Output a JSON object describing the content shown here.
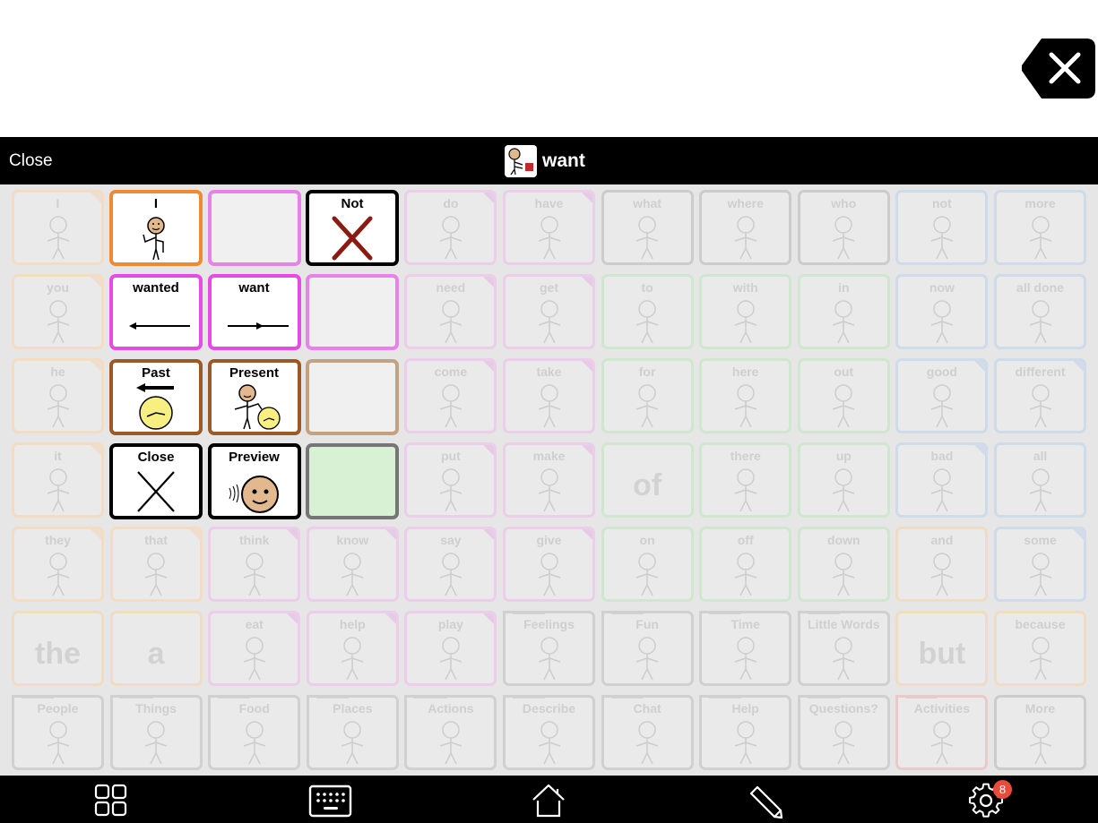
{
  "window": {
    "close_label": "Close",
    "title": "want",
    "title_icon": "want-symbol-icon"
  },
  "backspace": {
    "icon": "backspace-clear-icon"
  },
  "colors": {
    "pronoun": "#f0a04b",
    "verb": "#e987ea",
    "preposition": "#9ed89e",
    "adjective": "#9dc1e8",
    "question": "#9a9a9a",
    "folder": "#9a9a9a",
    "article": "#f0c080",
    "badge": "#e74c3c"
  },
  "board": {
    "cells": [
      {
        "label": "I",
        "type": "pronoun",
        "fold": true
      },
      {
        "label": "",
        "type": "hidden"
      },
      {
        "label": "",
        "type": "hidden"
      },
      {
        "label": "",
        "type": "hidden"
      },
      {
        "label": "do",
        "type": "verb",
        "fold": true
      },
      {
        "label": "have",
        "type": "verb",
        "fold": true
      },
      {
        "label": "what",
        "type": "question"
      },
      {
        "label": "where",
        "type": "question"
      },
      {
        "label": "who",
        "type": "question"
      },
      {
        "label": "not",
        "type": "adjective"
      },
      {
        "label": "more",
        "type": "adjective"
      },
      {
        "label": "you",
        "type": "pronoun",
        "fold": true
      },
      {
        "label": "",
        "type": "hidden"
      },
      {
        "label": "",
        "type": "hidden"
      },
      {
        "label": "",
        "type": "hidden"
      },
      {
        "label": "need",
        "type": "verb",
        "fold": true
      },
      {
        "label": "get",
        "type": "verb",
        "fold": true
      },
      {
        "label": "to",
        "type": "preposition"
      },
      {
        "label": "with",
        "type": "preposition"
      },
      {
        "label": "in",
        "type": "preposition"
      },
      {
        "label": "now",
        "type": "adjective"
      },
      {
        "label": "all done",
        "type": "adjective"
      },
      {
        "label": "he",
        "type": "pronoun",
        "fold": true
      },
      {
        "label": "",
        "type": "hidden"
      },
      {
        "label": "",
        "type": "hidden"
      },
      {
        "label": "",
        "type": "hidden"
      },
      {
        "label": "come",
        "type": "verb",
        "fold": true
      },
      {
        "label": "take",
        "type": "verb",
        "fold": true
      },
      {
        "label": "for",
        "type": "preposition"
      },
      {
        "label": "here",
        "type": "preposition"
      },
      {
        "label": "out",
        "type": "preposition"
      },
      {
        "label": "good",
        "type": "adjective",
        "fold": true
      },
      {
        "label": "different",
        "type": "adjective",
        "fold": true
      },
      {
        "label": "it",
        "type": "pronoun",
        "fold": true
      },
      {
        "label": "",
        "type": "hidden"
      },
      {
        "label": "",
        "type": "hidden"
      },
      {
        "label": "",
        "type": "hidden"
      },
      {
        "label": "put",
        "type": "verb",
        "fold": true
      },
      {
        "label": "make",
        "type": "verb",
        "fold": true
      },
      {
        "label": "",
        "big": "of",
        "type": "preposition"
      },
      {
        "label": "there",
        "type": "preposition"
      },
      {
        "label": "up",
        "type": "preposition"
      },
      {
        "label": "bad",
        "type": "adjective",
        "fold": true
      },
      {
        "label": "all",
        "type": "adjective"
      },
      {
        "label": "they",
        "type": "pronoun",
        "fold": true
      },
      {
        "label": "that",
        "type": "pronoun",
        "fold": true
      },
      {
        "label": "think",
        "type": "verb",
        "fold": true
      },
      {
        "label": "know",
        "type": "verb",
        "fold": true
      },
      {
        "label": "say",
        "type": "verb",
        "fold": true
      },
      {
        "label": "give",
        "type": "verb",
        "fold": true
      },
      {
        "label": "on",
        "type": "preposition"
      },
      {
        "label": "off",
        "type": "preposition"
      },
      {
        "label": "down",
        "type": "preposition"
      },
      {
        "label": "and",
        "type": "article"
      },
      {
        "label": "some",
        "type": "adjective",
        "fold": true
      },
      {
        "label": "",
        "big": "the",
        "type": "article"
      },
      {
        "label": "",
        "big": "a",
        "type": "article"
      },
      {
        "label": "eat",
        "type": "verb",
        "fold": true
      },
      {
        "label": "help",
        "type": "verb",
        "fold": true
      },
      {
        "label": "play",
        "type": "verb",
        "fold": true
      },
      {
        "label": "Feelings",
        "type": "folder"
      },
      {
        "label": "Fun",
        "type": "folder"
      },
      {
        "label": "Time",
        "type": "folder"
      },
      {
        "label": "Little Words",
        "type": "folder"
      },
      {
        "label": "",
        "big": "but",
        "type": "article"
      },
      {
        "label": "because",
        "type": "article"
      },
      {
        "label": "People",
        "type": "folder"
      },
      {
        "label": "Things",
        "type": "folder"
      },
      {
        "label": "Food",
        "type": "folder"
      },
      {
        "label": "Places",
        "type": "folder"
      },
      {
        "label": "Actions",
        "type": "folder"
      },
      {
        "label": "Describe",
        "type": "folder"
      },
      {
        "label": "Chat",
        "type": "folder"
      },
      {
        "label": "Help",
        "type": "folder"
      },
      {
        "label": "Questions?",
        "type": "folder"
      },
      {
        "label": "Activities",
        "type": "folder-red"
      },
      {
        "label": "More",
        "type": "more"
      }
    ]
  },
  "popup": {
    "cells": [
      {
        "label": "I",
        "border": "#ef8a33",
        "bg": "#ffffff",
        "icon": "person-pointing-self-icon"
      },
      {
        "label": "",
        "border": "#e882ea",
        "bg": "#f0f0f0",
        "icon": ""
      },
      {
        "label": "Not",
        "border": "#000000",
        "bg": "#ffffff",
        "icon": "red-x-icon"
      },
      {
        "label": "wanted",
        "border": "#e84ae8",
        "bg": "#ffffff",
        "icon": "arrow-left-icon"
      },
      {
        "label": "want",
        "border": "#e84ae8",
        "bg": "#ffffff",
        "icon": "arrow-right-icon"
      },
      {
        "label": "",
        "border": "#e882ea",
        "bg": "#f0f0f0",
        "icon": ""
      },
      {
        "label": "Past",
        "border": "#9b5a25",
        "bg": "#ffffff",
        "icon": "past-clock-icon"
      },
      {
        "label": "Present",
        "border": "#9b5a25",
        "bg": "#ffffff",
        "icon": "present-person-clock-icon"
      },
      {
        "label": "",
        "border": "#c3a282",
        "bg": "#f0f0f0",
        "icon": ""
      },
      {
        "label": "Close",
        "border": "#000000",
        "bg": "#ffffff",
        "icon": "close-x-icon"
      },
      {
        "label": "Preview",
        "border": "#000000",
        "bg": "#ffffff",
        "icon": "preview-hearing-face-icon"
      },
      {
        "label": "",
        "border": "#767676",
        "bg": "#d8f0d4",
        "icon": ""
      }
    ]
  },
  "toolbar": {
    "items": [
      {
        "name": "grid-button",
        "icon": "grid-icon"
      },
      {
        "name": "keyboard-button",
        "icon": "keyboard-icon"
      },
      {
        "name": "home-button",
        "icon": "home-icon"
      },
      {
        "name": "edit-button",
        "icon": "pencil-icon"
      },
      {
        "name": "settings-button",
        "icon": "gear-icon"
      }
    ],
    "settings_badge": "8"
  }
}
